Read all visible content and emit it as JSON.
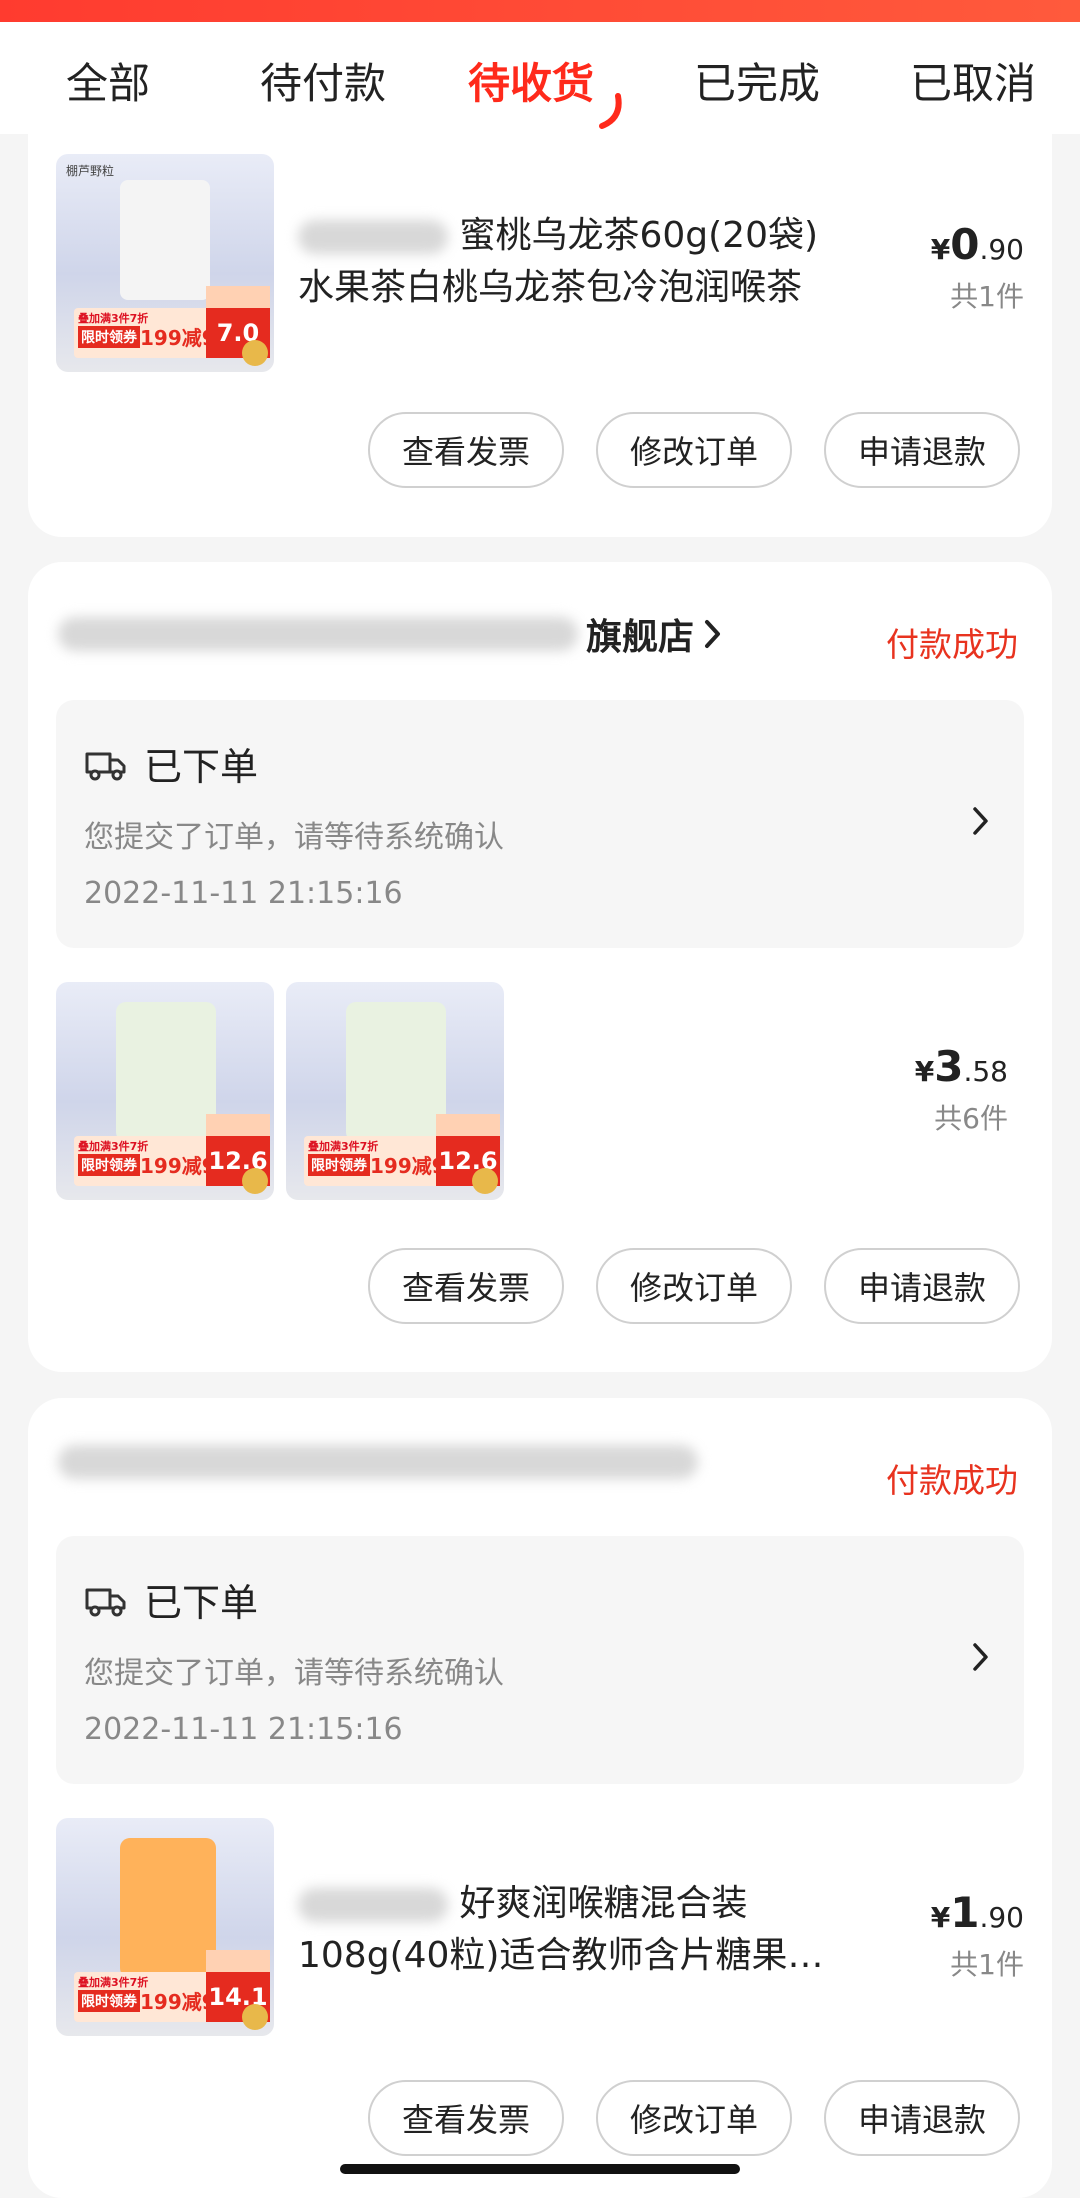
{
  "tabs": [
    {
      "label": "全部"
    },
    {
      "label": "待付款"
    },
    {
      "label": "待收货"
    },
    {
      "label": "已完成"
    },
    {
      "label": "已取消"
    }
  ],
  "active_tab_index": 2,
  "accent_color": "#ff2a1b",
  "orders": [
    {
      "product": {
        "title_line1": "蜜桃乌龙茶60g(20袋)",
        "title_line2": "水果茶白桃乌龙茶包冷泡润喉茶",
        "thumb_brand": "棚芦野粒",
        "promo_label": "叠加满3件7折",
        "promo_tag": "限时领券",
        "promo_amount": "199减99",
        "promo_price": "7.0",
        "price_int": "0",
        "price_dec": ".90",
        "quantity": "共1件"
      },
      "buttons": {
        "invoice": "查看发票",
        "modify": "修改订单",
        "refund": "申请退款"
      }
    },
    {
      "shop_name_suffix": "旗舰店",
      "status": "付款成功",
      "logistics": {
        "title": "已下单",
        "desc": "您提交了订单，请等待系统确认",
        "time": "2022-11-11 21:15:16"
      },
      "thumbs": [
        {
          "promo_label": "叠加满3件7折",
          "promo_tag": "限时领券",
          "promo_amount": "199减99",
          "promo_price": "12.6"
        },
        {
          "promo_label": "叠加满3件7折",
          "promo_tag": "限时领券",
          "promo_amount": "199减99",
          "promo_price": "12.6"
        }
      ],
      "price_int": "3",
      "price_dec": ".58",
      "quantity": "共6件",
      "buttons": {
        "invoice": "查看发票",
        "modify": "修改订单",
        "refund": "申请退款"
      }
    },
    {
      "status": "付款成功",
      "logistics": {
        "title": "已下单",
        "desc": "您提交了订单，请等待系统确认",
        "time": "2022-11-11 21:15:16"
      },
      "product": {
        "title_line1": "好爽润喉糖混合装",
        "title_line2": "108g(40粒)适合教师含片糖果…",
        "promo_label": "叠加满3件7折",
        "promo_tag": "限时领券",
        "promo_amount": "199减99",
        "promo_price": "14.1",
        "price_int": "1",
        "price_dec": ".90",
        "quantity": "共1件"
      },
      "buttons": {
        "invoice": "查看发票",
        "modify": "修改订单",
        "refund": "申请退款"
      }
    }
  ],
  "currency_symbol": "¥"
}
